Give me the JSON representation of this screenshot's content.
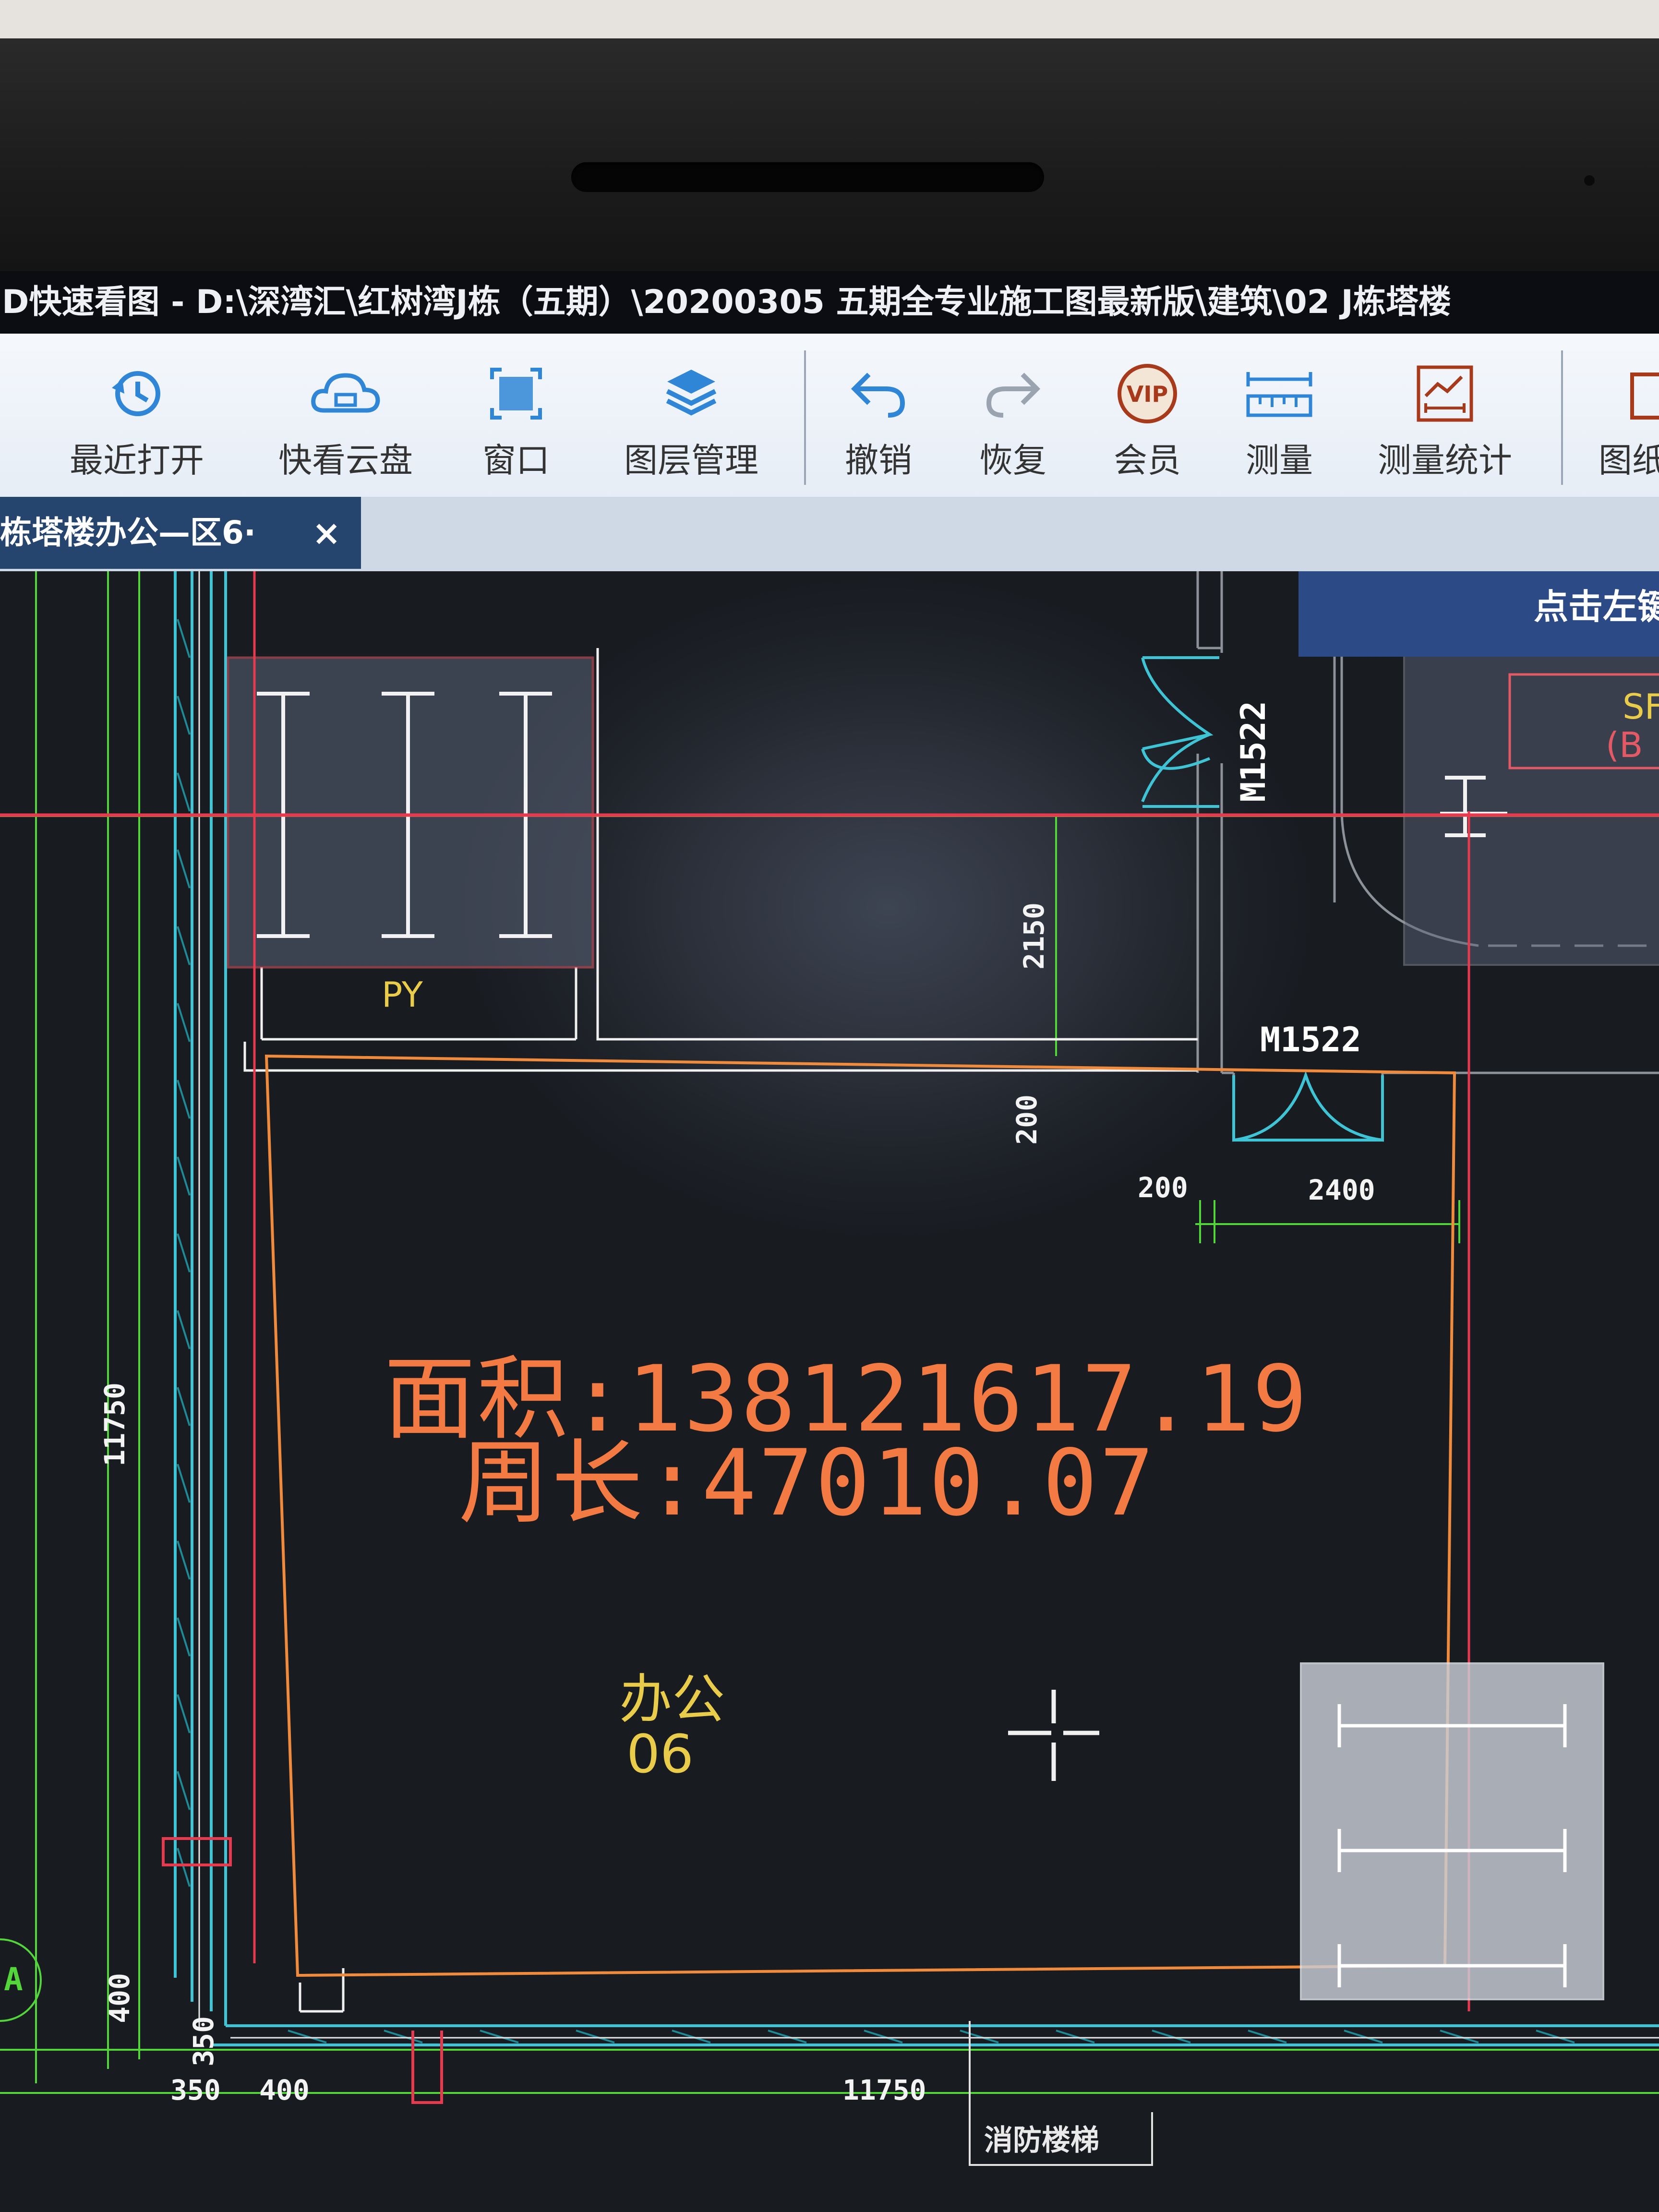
{
  "window": {
    "title": "D快速看图 - D:\\深湾汇\\红树湾J栋（五期）\\20200305  五期全专业施工图最新版\\建筑\\02 J栋塔楼"
  },
  "toolbar": {
    "items": [
      {
        "label": "最近打开",
        "icon": "clock-history-icon"
      },
      {
        "label": "快看云盘",
        "icon": "cloud-icon"
      },
      {
        "label": "窗口",
        "icon": "window-select-icon"
      },
      {
        "label": "图层管理",
        "icon": "layers-icon"
      },
      {
        "label": "撤销",
        "icon": "undo-icon"
      },
      {
        "label": "恢复",
        "icon": "redo-icon"
      },
      {
        "label": "会员",
        "icon": "vip-icon"
      },
      {
        "label": "测量",
        "icon": "ruler-icon"
      },
      {
        "label": "测量统计",
        "icon": "measure-stats-icon"
      },
      {
        "label": "图纸",
        "icon": "drawing-icon"
      }
    ],
    "vip_badge": "VIP"
  },
  "tabs": [
    {
      "label": "栋塔楼办公—区6·",
      "close": "×"
    }
  ],
  "hint": {
    "text": "点击左键"
  },
  "drawing": {
    "measurement": {
      "area": "面积:138121617.19",
      "perimeter": "周长:47010.07"
    },
    "room": {
      "name": "办公",
      "number": "06"
    },
    "labels": {
      "py": "PY",
      "door_1": "M1522",
      "door_2": "M1522",
      "sf": "SF",
      "b": "(B",
      "stair": "消防楼梯"
    },
    "dimensions": {
      "d_2150": "2150",
      "d_200_v": "200",
      "d_200_h": "200",
      "d_2400": "2400",
      "d_11750_v": "11750",
      "d_400_v": "400",
      "d_350_v": "350",
      "d_350_h": "350",
      "d_400_h": "400",
      "d_11750_h": "11750",
      "axis": "A"
    }
  },
  "colors": {
    "measure_text": "#f47a43",
    "room_text": "#e9cc4a",
    "red_line": "#e83a4e",
    "cyan_line": "#3fc4d6",
    "green_dim": "#52d63a",
    "hint_bg": "#2c4a86",
    "tab_bg": "#25446e"
  }
}
